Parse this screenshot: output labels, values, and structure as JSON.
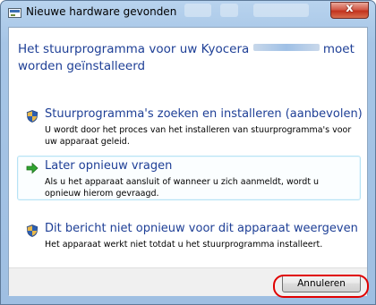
{
  "window": {
    "title": "Nieuwe hardware gevonden",
    "close_glyph": "x"
  },
  "heading": {
    "line1_before": "Het stuurprogramma voor uw Kyocera",
    "line1_after": "moet",
    "line2": "worden geïnstalleerd"
  },
  "options": [
    {
      "title": "Stuurprogramma's zoeken en installeren (aanbevolen)",
      "description": "U wordt door het proces van het installeren van stuurprogramma's voor uw apparaat geleid.",
      "icon": "shield-icon"
    },
    {
      "title": "Later opnieuw vragen",
      "description": "Als u het apparaat aansluit of wanneer u zich aanmeldt, wordt u opnieuw hierom gevraagd.",
      "icon": "green-arrow-icon"
    },
    {
      "title": "Dit bericht niet opnieuw voor dit apparaat weergeven",
      "description": "Het apparaat werkt niet totdat u het stuurprogramma installeert.",
      "icon": "shield-icon"
    }
  ],
  "footer": {
    "cancel_label": "Annuleren"
  },
  "colors": {
    "heading_text": "#1e3f96",
    "selected_border": "#b7e3f5",
    "highlight_ring": "#e00000"
  }
}
